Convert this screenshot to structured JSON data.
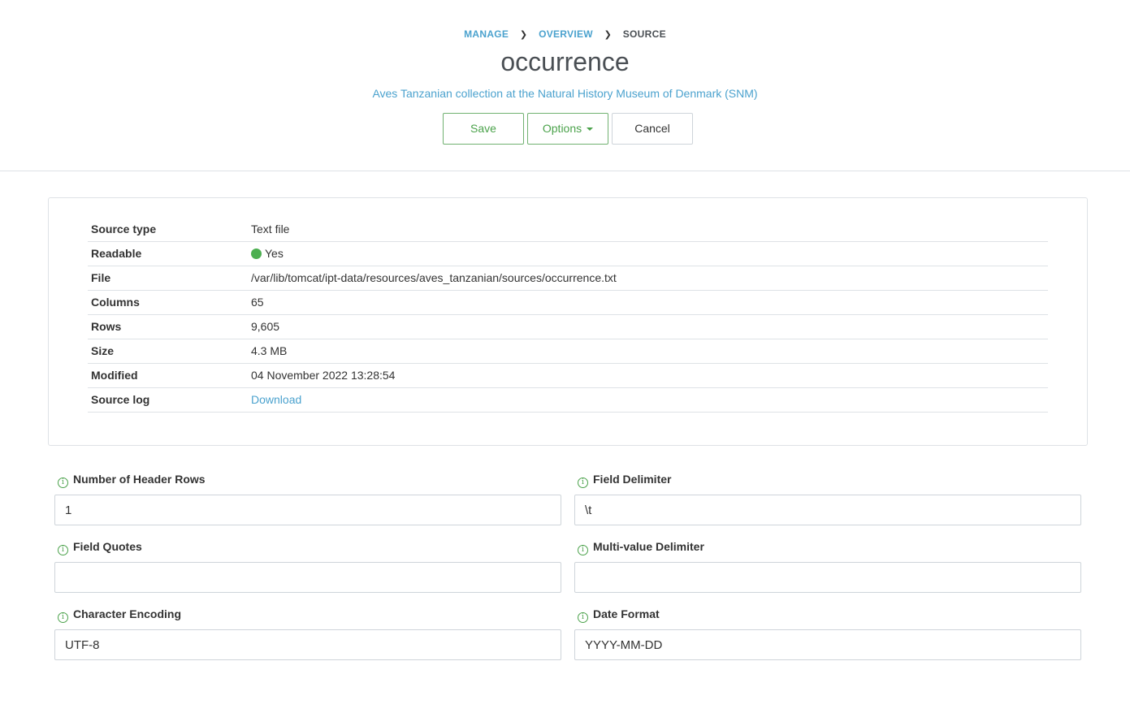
{
  "breadcrumb": {
    "manage": "MANAGE",
    "overview": "OVERVIEW",
    "current": "SOURCE"
  },
  "page": {
    "title": "occurrence",
    "subtitle": "Aves Tanzanian collection at the Natural History Museum of Denmark (SNM)"
  },
  "buttons": {
    "save": "Save",
    "options": "Options",
    "cancel": "Cancel"
  },
  "info": {
    "rows": [
      {
        "key": "Source type",
        "value": "Text file"
      },
      {
        "key": "Readable",
        "value": "Yes"
      },
      {
        "key": "File",
        "value": "/var/lib/tomcat/ipt-data/resources/aves_tanzanian/sources/occurrence.txt"
      },
      {
        "key": "Columns",
        "value": "65"
      },
      {
        "key": "Rows",
        "value": "9,605"
      },
      {
        "key": "Size",
        "value": "4.3 MB"
      },
      {
        "key": "Modified",
        "value": "04 November 2022 13:28:54"
      },
      {
        "key": "Source log",
        "value": "Download"
      }
    ]
  },
  "form": {
    "header_rows": {
      "label": "Number of Header Rows",
      "value": "1"
    },
    "field_delimiter": {
      "label": "Field Delimiter",
      "value": "\\t"
    },
    "field_quotes": {
      "label": "Field Quotes",
      "value": ""
    },
    "multi_value_delimiter": {
      "label": "Multi-value Delimiter",
      "value": ""
    },
    "character_encoding": {
      "label": "Character Encoding",
      "value": "UTF-8"
    },
    "date_format": {
      "label": "Date Format",
      "value": "YYYY-MM-DD"
    }
  },
  "colors": {
    "accent_green": "#4ba24b",
    "link_blue": "#4ba2ce",
    "status_green": "#4caf50"
  }
}
